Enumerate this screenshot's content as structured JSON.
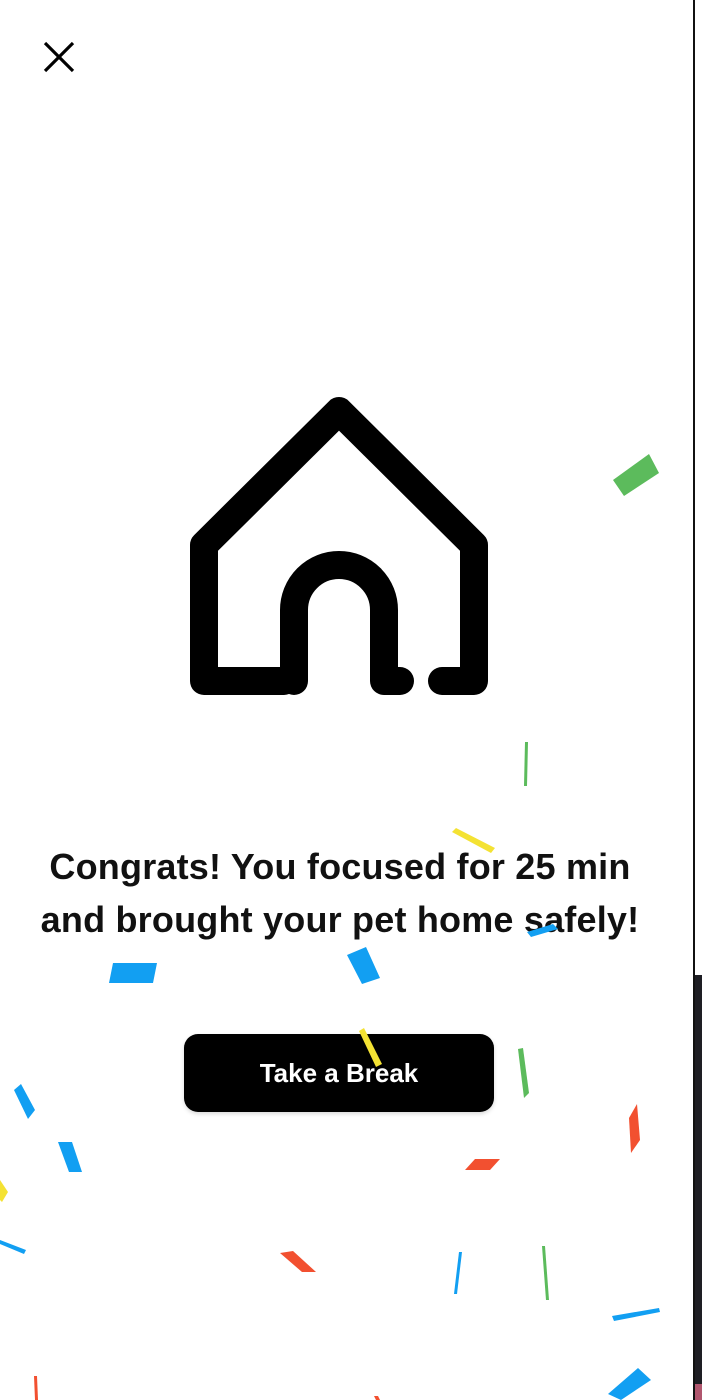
{
  "dialog": {
    "close_icon": "close-icon",
    "illustration_icon": "dog-house-icon",
    "message": "Congrats! You focused for 25 min and brought your pet home safely!",
    "button_label": "Take a Break"
  },
  "colors": {
    "background": "#ffffff",
    "text": "#111111",
    "button_bg": "#000000",
    "button_text": "#ffffff",
    "confetti_blue": "#129ff2",
    "confetti_green": "#5cbb5c",
    "confetti_yellow": "#f4e233",
    "confetti_red": "#f25030"
  }
}
